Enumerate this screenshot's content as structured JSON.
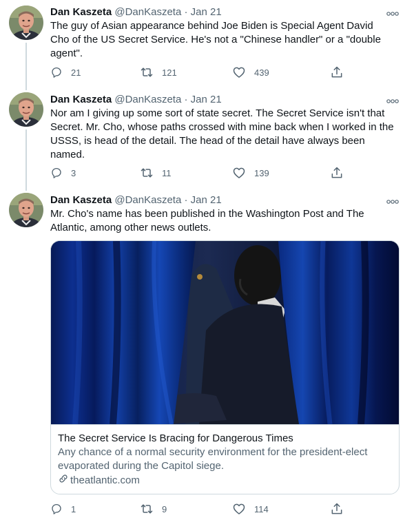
{
  "author": {
    "name": "Dan Kaszeta",
    "handle": "@DanKaszeta",
    "separator": "·"
  },
  "tweets": [
    {
      "date": "Jan 21",
      "text": "The guy of Asian appearance behind Joe Biden is Special Agent David Cho of the US Secret Service. He's not a \"Chinese handler\" or a \"double agent\".",
      "replies": "21",
      "retweets": "121",
      "likes": "439"
    },
    {
      "date": "Jan 21",
      "text": "Nor am I giving up some sort of state secret. The Secret Service isn't that Secret. Mr. Cho, whose paths crossed with mine back when I worked in the USSS, is head of the detail. The head of the detail have always been named.",
      "replies": "3",
      "retweets": "11",
      "likes": "139"
    },
    {
      "date": "Jan 21",
      "text": "Mr. Cho's name has been published in the Washington Post and The Atlantic, among other news outlets.",
      "replies": "1",
      "retweets": "9",
      "likes": "114"
    }
  ],
  "link_card": {
    "title": "The Secret Service Is Bracing for Dangerous Times",
    "description": "Any chance of a normal security environment for the president-elect evaporated during the Capitol siege.",
    "domain": "theatlantic.com"
  },
  "icons": {
    "more": "more-icon",
    "reply": "reply-icon",
    "retweet": "retweet-icon",
    "like": "heart-icon",
    "share": "share-icon",
    "link": "link-icon"
  },
  "colors": {
    "text": "#0f1419",
    "secondary": "#536471",
    "border": "#cfd9de",
    "curtain": "#0b2a7a"
  }
}
